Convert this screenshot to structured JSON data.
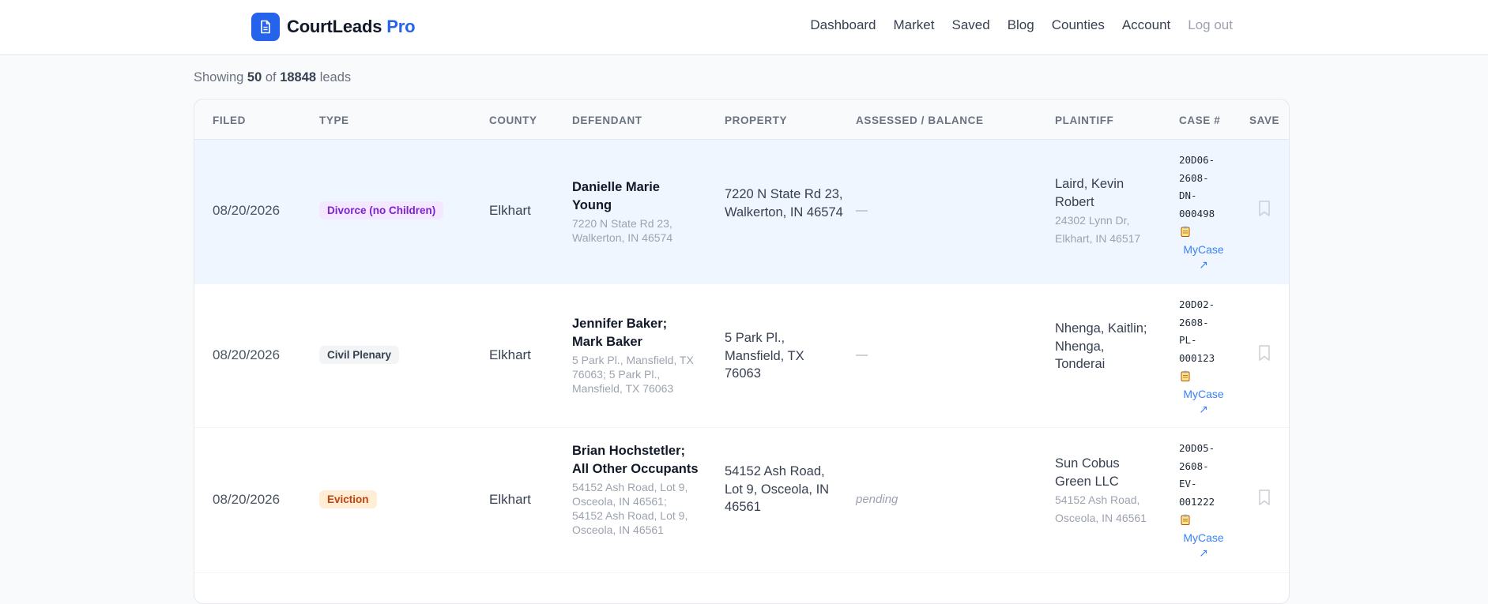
{
  "brand": {
    "name": "CourtLeads",
    "suffix": "Pro",
    "logo_icon": "document-icon",
    "accent": "#2563eb"
  },
  "nav": [
    {
      "label": "Dashboard"
    },
    {
      "label": "Market"
    },
    {
      "label": "Saved"
    },
    {
      "label": "Blog"
    },
    {
      "label": "Counties"
    },
    {
      "label": "Account"
    },
    {
      "label": "Log out"
    }
  ],
  "summary": {
    "prefix": "Showing",
    "shown": "50",
    "of": "of",
    "total": "18848",
    "suffix": "leads"
  },
  "table": {
    "columns": [
      "FILED",
      "TYPE",
      "COUNTY",
      "DEFENDANT",
      "PROPERTY",
      "ASSESSED / BALANCE",
      "PLAINTIFF",
      "CASE #",
      "SAVE"
    ],
    "rows": [
      {
        "filed": "08/20/2026",
        "type": "Divorce (no Children)",
        "type_color": "purple",
        "county": "Elkhart",
        "defendant_name": "Danielle Marie Young",
        "defendant_addr": "7220 N State Rd 23, Walkerton, IN 46574",
        "property": "7220 N State Rd 23, Walkerton, IN 46574",
        "assessed": "—",
        "plaintiff_name": "Laird, Kevin Robert",
        "plaintiff_addr": "24302 Lynn Dr, Elkhart, IN 46517",
        "case_num": "20D06-2608-DN-000498",
        "case_link": "MyCase ↗",
        "save_icon": "bookmark-icon"
      },
      {
        "filed": "08/20/2026",
        "type": "Civil Plenary",
        "type_color": "gray",
        "county": "Elkhart",
        "defendant_name": "Jennifer Baker; Mark Baker",
        "defendant_addr": "5 Park Pl., Mansfield, TX 76063; 5 Park Pl., Mansfield, TX 76063",
        "property": "5 Park Pl., Mansfield, TX 76063",
        "assessed": "—",
        "plaintiff_name": "Nhenga, Kaitlin; Nhenga, Tonderai",
        "plaintiff_addr": "",
        "case_num": "20D02-2608-PL-000123",
        "case_link": "MyCase ↗",
        "save_icon": "bookmark-icon"
      },
      {
        "filed": "08/20/2026",
        "type": "Eviction",
        "type_color": "orange",
        "county": "Elkhart",
        "defendant_name": "Brian Hochstetler; All Other Occupants",
        "defendant_addr": "54152 Ash Road, Lot 9, Osceola, IN 46561; 54152 Ash Road, Lot 9, Osceola, IN 46561",
        "property": "54152 Ash Road, Lot 9, Osceola, IN 46561",
        "assessed": "pending",
        "plaintiff_name": "Sun Cobus Green LLC",
        "plaintiff_addr": "54152 Ash Road, Osceola, IN 46561",
        "case_num": "20D05-2608-EV-001222",
        "case_link": "MyCase ↗",
        "save_icon": "bookmark-icon"
      }
    ]
  }
}
